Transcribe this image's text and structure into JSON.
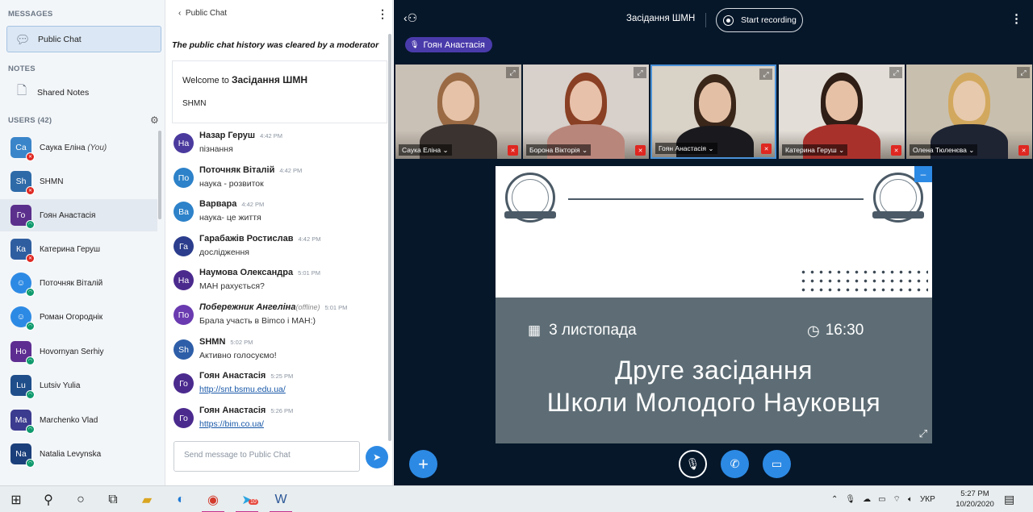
{
  "left_panel": {
    "messages_header": "MESSAGES",
    "public_chat_label": "Public Chat",
    "notes_header": "NOTES",
    "shared_notes_label": "Shared Notes",
    "users_header": "USERS (42)",
    "users": [
      {
        "initials": "Са",
        "name": "Саука Еліна",
        "suffix": "(You)",
        "color": "#3a85c9"
      },
      {
        "initials": "Sh",
        "name": "SHMN",
        "suffix": "",
        "color": "#2e6aa8"
      },
      {
        "initials": "Го",
        "name": "Гоян Анастасія",
        "suffix": "",
        "color": "#5b2f8c"
      },
      {
        "initials": "Ка",
        "name": "Катерина Геруш",
        "suffix": "",
        "color": "#2f5ea0"
      },
      {
        "initials": "☺",
        "name": "Поточняк Віталій",
        "suffix": "",
        "color": "#2d8ae4"
      },
      {
        "initials": "☺",
        "name": "Роман Огороднік",
        "suffix": "",
        "color": "#2d8ae4"
      },
      {
        "initials": "Ho",
        "name": "Hovornyan Serhiy",
        "suffix": "",
        "color": "#5e2d91"
      },
      {
        "initials": "Lu",
        "name": "Lutsiv Yulia",
        "suffix": "",
        "color": "#1f4e8a"
      },
      {
        "initials": "Ma",
        "name": "Marchenko Vlad",
        "suffix": "",
        "color": "#3b3b8f"
      },
      {
        "initials": "Na",
        "name": "Natalia Levynska",
        "suffix": "",
        "color": "#1b3f7a"
      }
    ]
  },
  "chat": {
    "title": "Public Chat",
    "cleared_notice": "The public chat history was cleared by a moderator",
    "welcome_prefix": "Welcome to",
    "welcome_room": "Засідання ШМН",
    "welcome_sub": "SHMN",
    "messages": [
      {
        "initials": "На",
        "author": "Назар Геруш",
        "offline": "",
        "time": "4:42 PM",
        "text": "пізнання",
        "link": false,
        "color": "#4b3a9e"
      },
      {
        "initials": "По",
        "author": "Поточняк Віталій",
        "offline": "",
        "time": "4:42 PM",
        "text": "наука - розвиток",
        "link": false,
        "color": "#2d82c9"
      },
      {
        "initials": "Ва",
        "author": "Варвара",
        "offline": "",
        "time": "4:42 PM",
        "text": "наука- це життя",
        "link": false,
        "color": "#2d82c9"
      },
      {
        "initials": "Га",
        "author": "Гарабажів Ростислав",
        "offline": "",
        "time": "4:42 PM",
        "text": "дослідження",
        "link": false,
        "color": "#2b3d8c"
      },
      {
        "initials": "На",
        "author": "Наумова Олександра",
        "offline": "",
        "time": "5:01 PM",
        "text": "МАН рахується?",
        "link": false,
        "color": "#4b2a8e"
      },
      {
        "initials": "По",
        "author": "Побережник Ангеліна",
        "offline": "(offline)",
        "time": "5:01 PM",
        "text": "Брала участь в Bimco і МАН:)",
        "link": false,
        "color": "#6a3ab0"
      },
      {
        "initials": "Sh",
        "author": "SHMN",
        "offline": "",
        "time": "5:02 PM",
        "text": "Активно голосуємо!",
        "link": false,
        "color": "#2e5ea8"
      },
      {
        "initials": "Го",
        "author": "Гоян Анастасія",
        "offline": "",
        "time": "5:25 PM",
        "text": "http://snt.bsmu.edu.ua/",
        "link": true,
        "color": "#4b2a8e"
      },
      {
        "initials": "Го",
        "author": "Гоян Анастасія",
        "offline": "",
        "time": "5:26 PM",
        "text": "https://bim.co.ua/",
        "link": true,
        "color": "#4b2a8e"
      }
    ],
    "input_placeholder": "Send message to Public Chat"
  },
  "main": {
    "meeting_title": "Засідання ШМН",
    "record_label": "Start recording",
    "talking_user": "Гоян Анастасія",
    "videos": [
      {
        "name": "Саука Еліна",
        "bg": "#c9c0b6",
        "skin": "#e5c2a8",
        "hair": "#9a6a44",
        "shirt": "#3b3330"
      },
      {
        "name": "Борона Вікторія",
        "bg": "#d7d0cb",
        "skin": "#e8c1aa",
        "hair": "#8a4024",
        "shirt": "#b9867b"
      },
      {
        "name": "Гоян Анастасія",
        "bg": "#d9d2c7",
        "skin": "#e3c0a5",
        "hair": "#3b261a",
        "shirt": "#1a1a1e"
      },
      {
        "name": "Катерина Геруш",
        "bg": "#e3dfd8",
        "skin": "#e6c1a6",
        "hair": "#2f1e16",
        "shirt": "#a9312c"
      },
      {
        "name": "Олена Тюленєва",
        "bg": "#c8bfae",
        "skin": "#e7c9ad",
        "hair": "#d2a85e",
        "shirt": "#1f2433"
      }
    ],
    "slide": {
      "date": "3 листопада",
      "time": "16:30",
      "title_line1": "Друге засідання",
      "title_line2": "Школи Молодого Науковця"
    }
  },
  "taskbar": {
    "lang": "УКР",
    "time": "5:27 PM",
    "date": "10/20/2020",
    "telegram_badge": "10"
  }
}
